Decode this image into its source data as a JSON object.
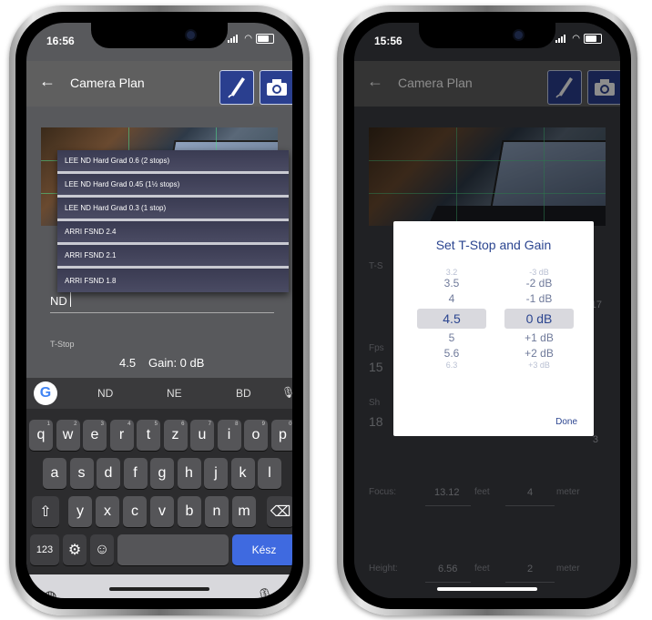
{
  "left_phone": {
    "status_time": "16:56",
    "app_title": "Camera Plan",
    "dropdown_items": [
      "LEE ND Hard Grad 0.6 (2 stops)",
      "LEE ND Hard Grad 0.45 (1½ stops)",
      "LEE ND Hard Grad 0.3 (1 stop)",
      "ARRI FSND 2.4",
      "ARRI FSND 2.1",
      "ARRI FSND 1.8"
    ],
    "nd_input_value": "ND",
    "tstop_label": "T-Stop",
    "tstop_value": "4.5",
    "gain_text": "Gain: 0 dB",
    "suggestions": [
      "ND",
      "NE",
      "BD"
    ],
    "keyboard_row1": [
      "q",
      "w",
      "e",
      "r",
      "t",
      "z",
      "u",
      "i",
      "o",
      "p"
    ],
    "keyboard_row1_hints": [
      "1",
      "2",
      "3",
      "4",
      "5",
      "6",
      "7",
      "8",
      "9",
      "0"
    ],
    "keyboard_row2": [
      "a",
      "s",
      "d",
      "f",
      "g",
      "h",
      "j",
      "k",
      "l"
    ],
    "keyboard_row3": [
      "y",
      "x",
      "c",
      "v",
      "b",
      "n",
      "m"
    ],
    "numbers_key": "123",
    "enter_key": "Kész"
  },
  "right_phone": {
    "status_time": "15:56",
    "app_title": "Camera Plan",
    "dialog_title": "Set T-Stop and Gain",
    "tstop_values_above": [
      "3.2",
      "3.5",
      "4"
    ],
    "tstop_selected": "4.5",
    "tstop_values_below": [
      "5",
      "5.6",
      "6.3"
    ],
    "gain_values_above": [
      "-3 dB",
      "-2 dB",
      "-1 dB"
    ],
    "gain_selected": "0 dB",
    "gain_values_below": [
      "+1 dB",
      "+2 dB",
      "+3 dB"
    ],
    "done_label": "Done",
    "bg_fps_label": "Fps",
    "bg_fps_value": "15",
    "bg_shutter_label": "Sh",
    "bg_shutter_value": "18",
    "bg_t_label": "T-S",
    "bg_side_number_1": "17",
    "bg_side_number_2": "3",
    "focus_label": "Focus:",
    "focus_feet": "13.12",
    "focus_feet_unit": "feet",
    "focus_meter": "4",
    "focus_meter_unit": "meter",
    "height_label": "Height:",
    "height_feet": "6.56",
    "height_feet_unit": "feet",
    "height_meter": "2",
    "height_meter_unit": "meter"
  }
}
